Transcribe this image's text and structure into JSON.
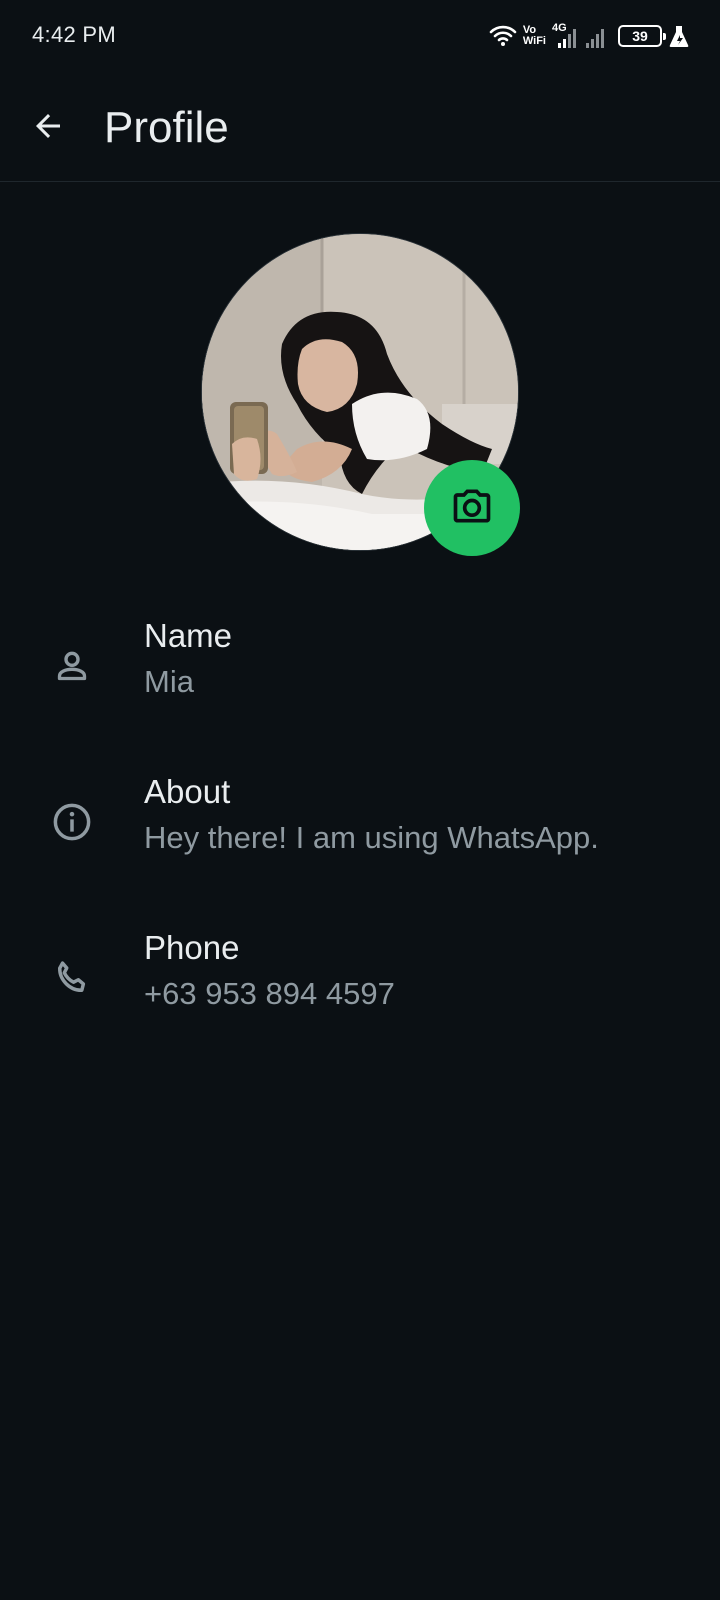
{
  "status_bar": {
    "time": "4:42 PM",
    "vo_label": "Vo",
    "wifi_label": "WiFi",
    "network_type": "4G",
    "battery_level": "39"
  },
  "header": {
    "title": "Profile",
    "back_icon": "arrow-left-icon"
  },
  "profile": {
    "camera_icon": "camera-icon",
    "fields": [
      {
        "label": "Name",
        "value": "Mia",
        "icon": "person-icon"
      },
      {
        "label": "About",
        "value": "Hey there! I am using WhatsApp.",
        "icon": "info-icon"
      },
      {
        "label": "Phone",
        "value": "+63 953 894 4597",
        "icon": "phone-icon"
      }
    ]
  },
  "colors": {
    "background": "#0b1014",
    "accent": "#21c063",
    "primary_text": "#e9edef",
    "secondary_text": "#8f9aa1",
    "icon": "#8f9aa1"
  }
}
